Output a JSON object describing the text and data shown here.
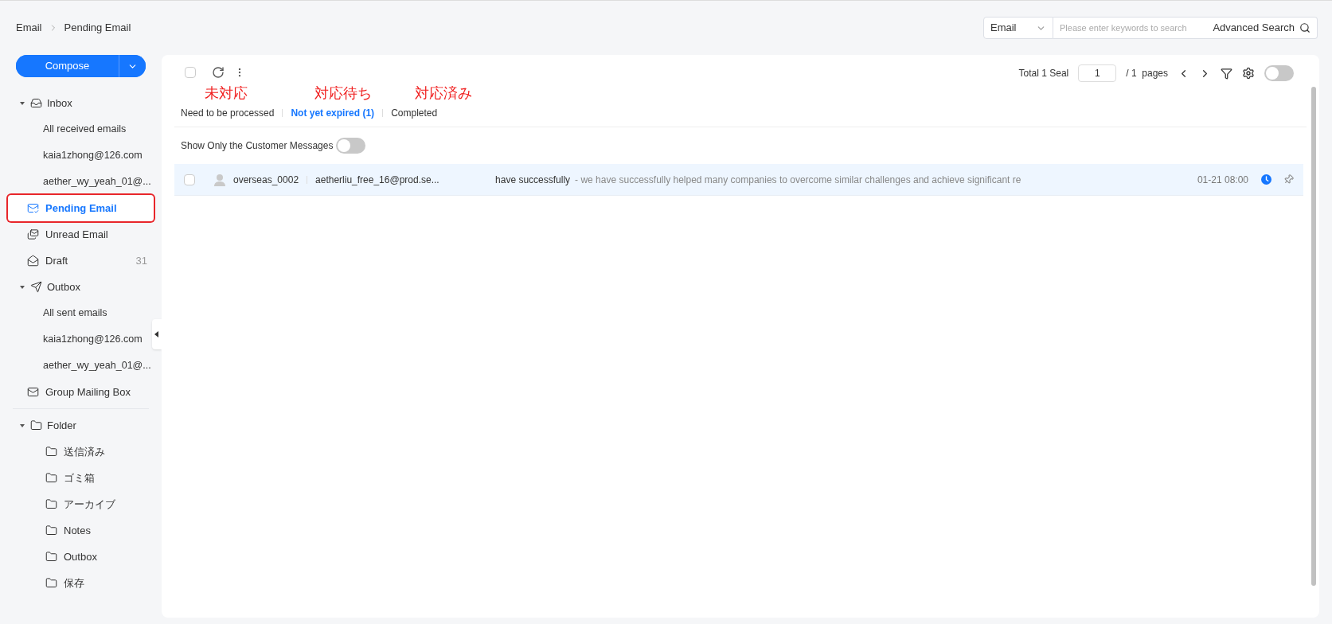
{
  "breadcrumb": [
    {
      "label": "Email"
    },
    {
      "label": "Pending Email"
    }
  ],
  "search": {
    "scope": "Email",
    "placeholder": "Please enter keywords to search",
    "advanced": "Advanced Search"
  },
  "compose": {
    "label": "Compose"
  },
  "sidebar": {
    "items": [
      {
        "kind": "group",
        "label": "Inbox",
        "expanded": true,
        "selected": false,
        "children": [
          {
            "kind": "account",
            "label": "All received emails",
            "selected": false
          },
          {
            "kind": "account",
            "label": "kaia1zhong@126.com",
            "selected": false
          },
          {
            "kind": "account",
            "label": "aether_wy_yeah_01@...",
            "selected": false
          }
        ]
      },
      {
        "kind": "view",
        "label": "Pending Email",
        "selected": true,
        "annotated": true
      },
      {
        "kind": "view",
        "label": "Unread Email",
        "selected": false,
        "annotated": false
      },
      {
        "kind": "view",
        "label": "Draft",
        "count": "31",
        "selected": false,
        "annotated": false
      },
      {
        "kind": "group",
        "label": "Outbox",
        "expanded": true,
        "selected": false,
        "children": [
          {
            "kind": "account",
            "label": "All sent emails",
            "selected": false
          },
          {
            "kind": "account",
            "label": "kaia1zhong@126.com",
            "selected": false
          },
          {
            "kind": "account",
            "label": "aether_wy_yeah_01@...",
            "selected": false
          }
        ]
      },
      {
        "kind": "view",
        "label": "Group Mailing Box",
        "selected": false,
        "annotated": false
      },
      {
        "kind": "divider"
      },
      {
        "kind": "group",
        "label": "Folder",
        "expanded": true,
        "selected": false,
        "children": [
          {
            "kind": "folder",
            "label": "送信済み",
            "selected": false
          },
          {
            "kind": "folder",
            "label": "ゴミ箱",
            "selected": false
          },
          {
            "kind": "folder",
            "label": "アーカイブ",
            "selected": false
          },
          {
            "kind": "folder",
            "label": "Notes",
            "selected": false
          },
          {
            "kind": "folder",
            "label": "Outbox",
            "selected": false
          },
          {
            "kind": "folder",
            "label": "保存",
            "selected": false
          }
        ]
      }
    ]
  },
  "tabs": [
    {
      "label": "Need to be processed",
      "annotation": "未対応",
      "selected": false
    },
    {
      "label": "Not yet expired (1)",
      "annotation": "対応待ち",
      "selected": true
    },
    {
      "label": "Completed",
      "annotation": "対応済み",
      "selected": false
    }
  ],
  "select_all": {
    "checked": false
  },
  "pagination": {
    "total": "Total 1 Seal",
    "page": "1",
    "pages": "/ 1  pages"
  },
  "view_toggle": {
    "on": false
  },
  "customer_filter": {
    "label": "Show Only the Customer Messages",
    "on": false
  },
  "emails": [
    {
      "checked": false,
      "name": "overseas_0002",
      "sender": "aetherliu_free_16@prod.se...",
      "subject": "have successfully",
      "preview": "- we have successfully helped many companies to overcome similar challenges and achieve significant re",
      "time": "01-21 08:00",
      "scheduled": true,
      "pinned": false,
      "selected": true
    }
  ]
}
